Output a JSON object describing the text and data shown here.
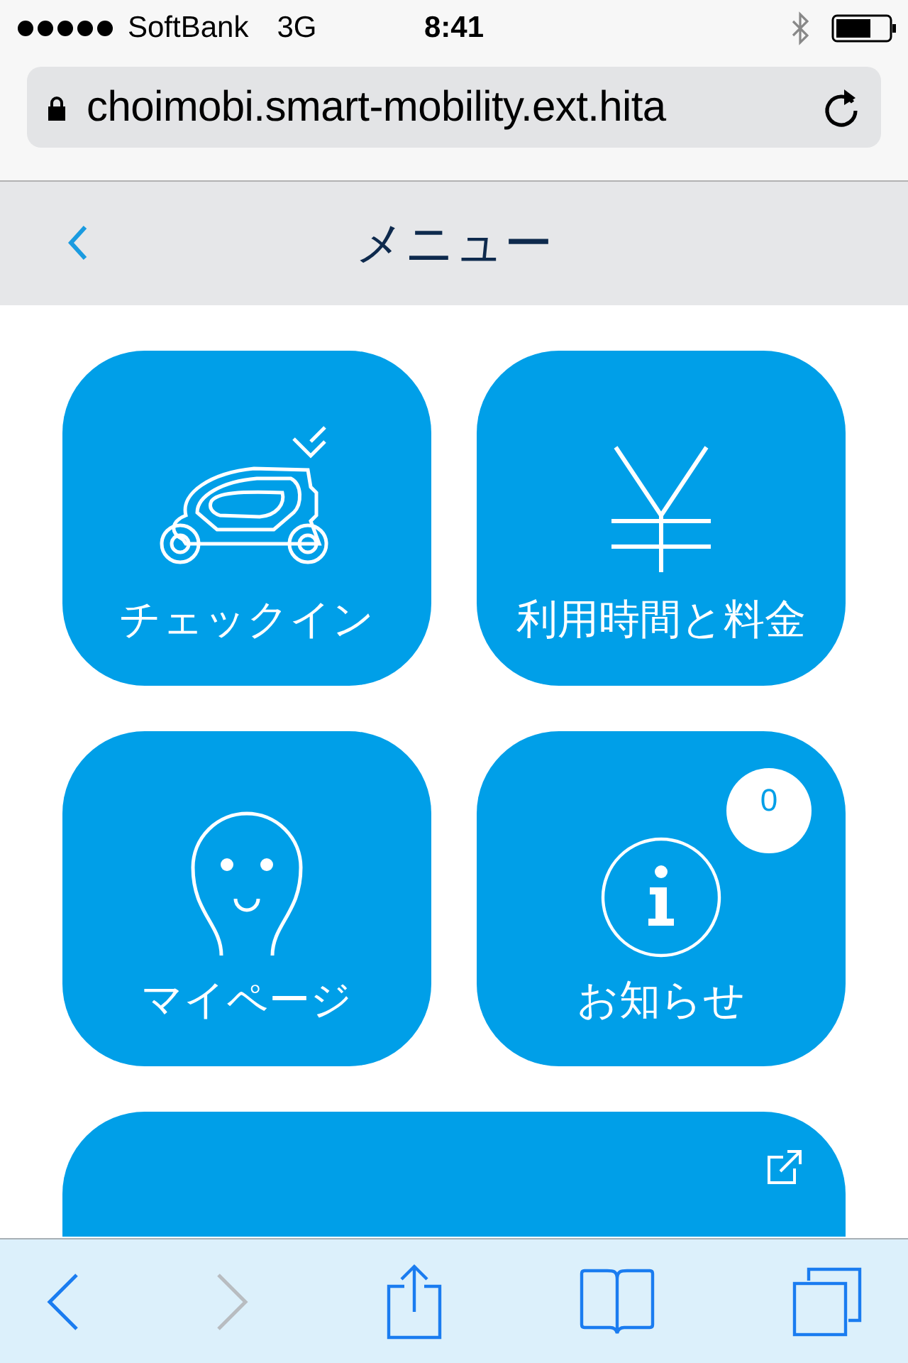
{
  "status_bar": {
    "carrier": "SoftBank",
    "network": "3G",
    "time": "8:41"
  },
  "address_bar": {
    "url": "choimobi.smart-mobility.ext.hita"
  },
  "header": {
    "title": "メニュー"
  },
  "tiles": [
    {
      "kind": "checkin",
      "label": "チェックイン"
    },
    {
      "kind": "fee",
      "label": "利用時間と料金"
    },
    {
      "kind": "mypage",
      "label": "マイページ"
    },
    {
      "kind": "info",
      "label": "お知らせ"
    },
    {
      "kind": "external"
    }
  ],
  "notice_badge": {
    "count": "0"
  },
  "toolbar": [
    {
      "kind": "back",
      "disabled": false
    },
    {
      "kind": "forward",
      "disabled": true
    },
    {
      "kind": "share",
      "disabled": false
    },
    {
      "kind": "bookmarks",
      "disabled": false
    },
    {
      "kind": "tabs",
      "disabled": false
    }
  ]
}
